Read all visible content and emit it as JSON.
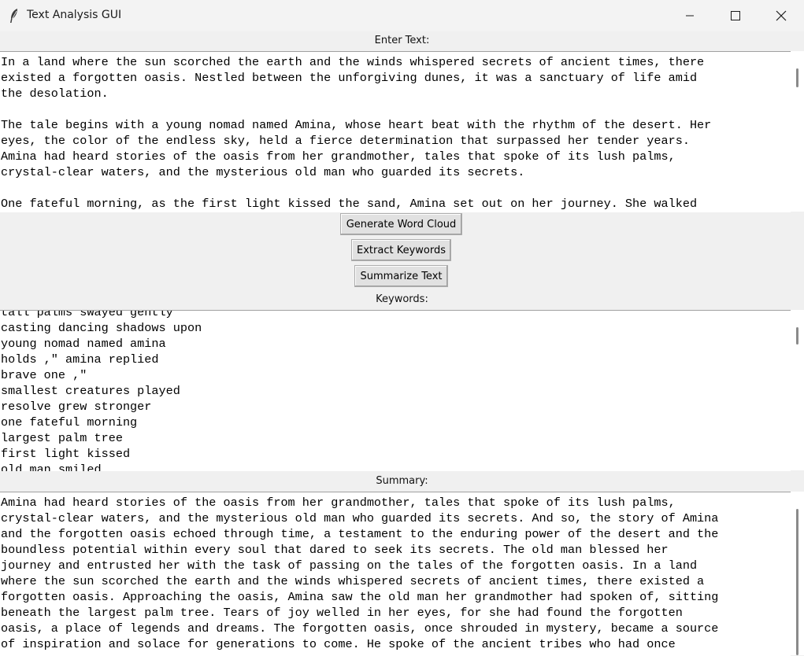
{
  "window": {
    "title": "Text Analysis GUI"
  },
  "input_section": {
    "label": "Enter Text:",
    "text": "In a land where the sun scorched the earth and the winds whispered secrets of ancient times, there\nexisted a forgotten oasis. Nestled between the unforgiving dunes, it was a sanctuary of life amid\nthe desolation.\n\nThe tale begins with a young nomad named Amina, whose heart beat with the rhythm of the desert. Her\neyes, the color of the endless sky, held a fierce determination that surpassed her tender years.\nAmina had heard stories of the oasis from her grandmother, tales that spoke of its lush palms,\ncrystal-clear waters, and the mysterious old man who guarded its secrets.\n\nOne fateful morning, as the first light kissed the sand, Amina set out on her journey. She walked"
  },
  "buttons": {
    "word_cloud": "Generate Word Cloud",
    "keywords": "Extract Keywords",
    "summarize": "Summarize Text"
  },
  "keywords_section": {
    "label": "Keywords:",
    "text": "tall palms swayed gently\ncasting dancing shadows upon\nyoung nomad named amina\nholds ,\" amina replied\nbrave one ,\"\nsmallest creatures played\nresolve grew stronger\none fateful morning\nlargest palm tree\nfirst light kissed\nold man smiled"
  },
  "summary_section": {
    "label": "Summary:",
    "text": "Amina had heard stories of the oasis from her grandmother, tales that spoke of its lush palms,\ncrystal-clear waters, and the mysterious old man who guarded its secrets. And so, the story of Amina\nand the forgotten oasis echoed through time, a testament to the enduring power of the desert and the\nboundless potential within every soul that dared to seek its secrets. The old man blessed her\njourney and entrusted her with the task of passing on the tales of the forgotten oasis. In a land\nwhere the sun scorched the earth and the winds whispered secrets of ancient times, there existed a\nforgotten oasis. Approaching the oasis, Amina saw the old man her grandmother had spoken of, sitting\nbeneath the largest palm tree. Tears of joy welled in her eyes, for she had found the forgotten\noasis, a place of legends and dreams. The forgotten oasis, once shrouded in mystery, became a source\nof inspiration and solace for generations to come. He spoke of the ancient tribes who had once"
  },
  "icons": {
    "app": "feather-icon",
    "minimize": "minimize-icon",
    "maximize": "maximize-icon",
    "close": "close-icon"
  }
}
